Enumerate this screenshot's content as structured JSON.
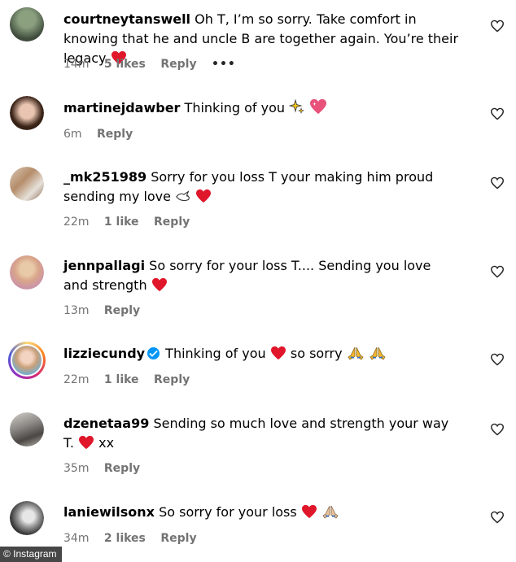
{
  "comments": [
    {
      "username": "courtneytanswell",
      "text": "Oh T, I’m so sorry. Take comfort in knowing that he and uncle B are together again. You’re their legacy",
      "time": "14m",
      "likes": "5 likes",
      "reply": "Reply",
      "more": "•••"
    },
    {
      "username": "martinejdawber",
      "text": "Thinking of you",
      "time": "6m",
      "reply": "Reply"
    },
    {
      "username": "_mk251989",
      "text": "Sorry for you loss T your making him proud sending my love",
      "time": "22m",
      "likes": "1 like",
      "reply": "Reply"
    },
    {
      "username": "jennpallagi",
      "text": "So sorry for your loss T.... Sending you love and strength",
      "time": "13m",
      "reply": "Reply"
    },
    {
      "username": "lizziecundy",
      "text_before": "Thinking of you",
      "text_after": "so sorry",
      "time": "22m",
      "likes": "1 like",
      "reply": "Reply"
    },
    {
      "username": "dzenetaa99",
      "text": "Sending so much love and strength your way T.",
      "text_tail": "xx",
      "time": "35m",
      "reply": "Reply"
    },
    {
      "username": "laniewilsonx",
      "text": "So sorry for your loss",
      "time": "34m",
      "likes": "2 likes",
      "reply": "Reply"
    }
  ],
  "watermark": "© Instagram",
  "colors": {
    "heart": "#e0162b",
    "meta": "#737373",
    "verified": "#0095f6"
  },
  "icons": [
    "heart-like-icon",
    "red-heart-emoji",
    "sparkles-emoji",
    "sparkling-heart-emoji",
    "dove-emoji",
    "praying-hands-emoji",
    "verified-badge-icon"
  ]
}
